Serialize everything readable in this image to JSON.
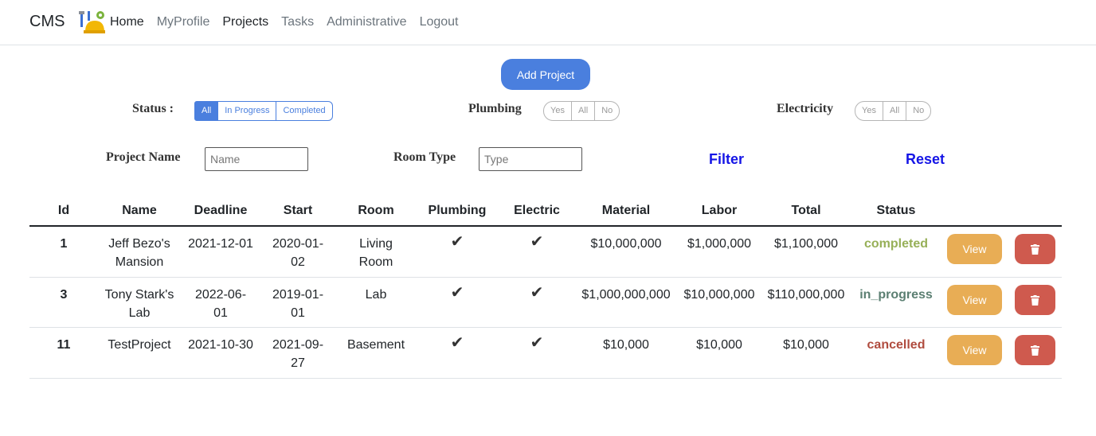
{
  "nav": {
    "brand": "CMS",
    "links": [
      {
        "label": "Home",
        "active": true
      },
      {
        "label": "MyProfile",
        "active": false
      },
      {
        "label": "Projects",
        "active": true
      },
      {
        "label": "Tasks",
        "active": false
      },
      {
        "label": "Administrative",
        "active": false
      },
      {
        "label": "Logout",
        "active": false
      }
    ]
  },
  "add_button": "Add Project",
  "filters": {
    "status_label": "Status :",
    "status_options": [
      "All",
      "In Progress",
      "Completed"
    ],
    "status_selected": "All",
    "plumbing_label": "Plumbing",
    "plumbing_options": [
      "Yes",
      "All",
      "No"
    ],
    "electricity_label": "Electricity",
    "electricity_options": [
      "Yes",
      "All",
      "No"
    ],
    "project_name_label": "Project Name",
    "project_name_placeholder": "Name",
    "project_name_value": "",
    "room_type_label": "Room Type",
    "room_type_placeholder": "Type",
    "room_type_value": "",
    "filter_label": "Filter",
    "reset_label": "Reset"
  },
  "table": {
    "headers": [
      "Id",
      "Name",
      "Deadline",
      "Start",
      "Room",
      "Plumbing",
      "Electric",
      "Material",
      "Labor",
      "Total",
      "Status"
    ],
    "rows": [
      {
        "id": "1",
        "name": "Jeff Bezo's Mansion",
        "deadline": "2021-12-01",
        "start": "2020-01-02",
        "room": "Living Room",
        "plumbing": "✔",
        "electric": "✔",
        "material": "$10,000,000",
        "labor": "$1,000,000",
        "total": "$1,100,000",
        "status": "completed",
        "view": "View"
      },
      {
        "id": "3",
        "name": "Tony Stark's Lab",
        "deadline": "2022-06-01",
        "start": "2019-01-01",
        "room": "Lab",
        "plumbing": "✔",
        "electric": "✔",
        "material": "$1,000,000,000",
        "labor": "$10,000,000",
        "total": "$110,000,000",
        "status": "in_progress",
        "view": "View"
      },
      {
        "id": "11",
        "name": "TestProject",
        "deadline": "2021-10-30",
        "start": "2021-09-27",
        "room": "Basement",
        "plumbing": "✔",
        "electric": "✔",
        "material": "$10,000",
        "labor": "$10,000",
        "total": "$10,000",
        "status": "cancelled",
        "view": "View"
      }
    ],
    "status_colors": {
      "completed": "#97b058",
      "in_progress": "#5b7f72",
      "cancelled": "#b04c3f"
    }
  },
  "icons": {
    "logo": "construction-tools-icon",
    "delete": "trash-icon",
    "check": "check-icon"
  }
}
